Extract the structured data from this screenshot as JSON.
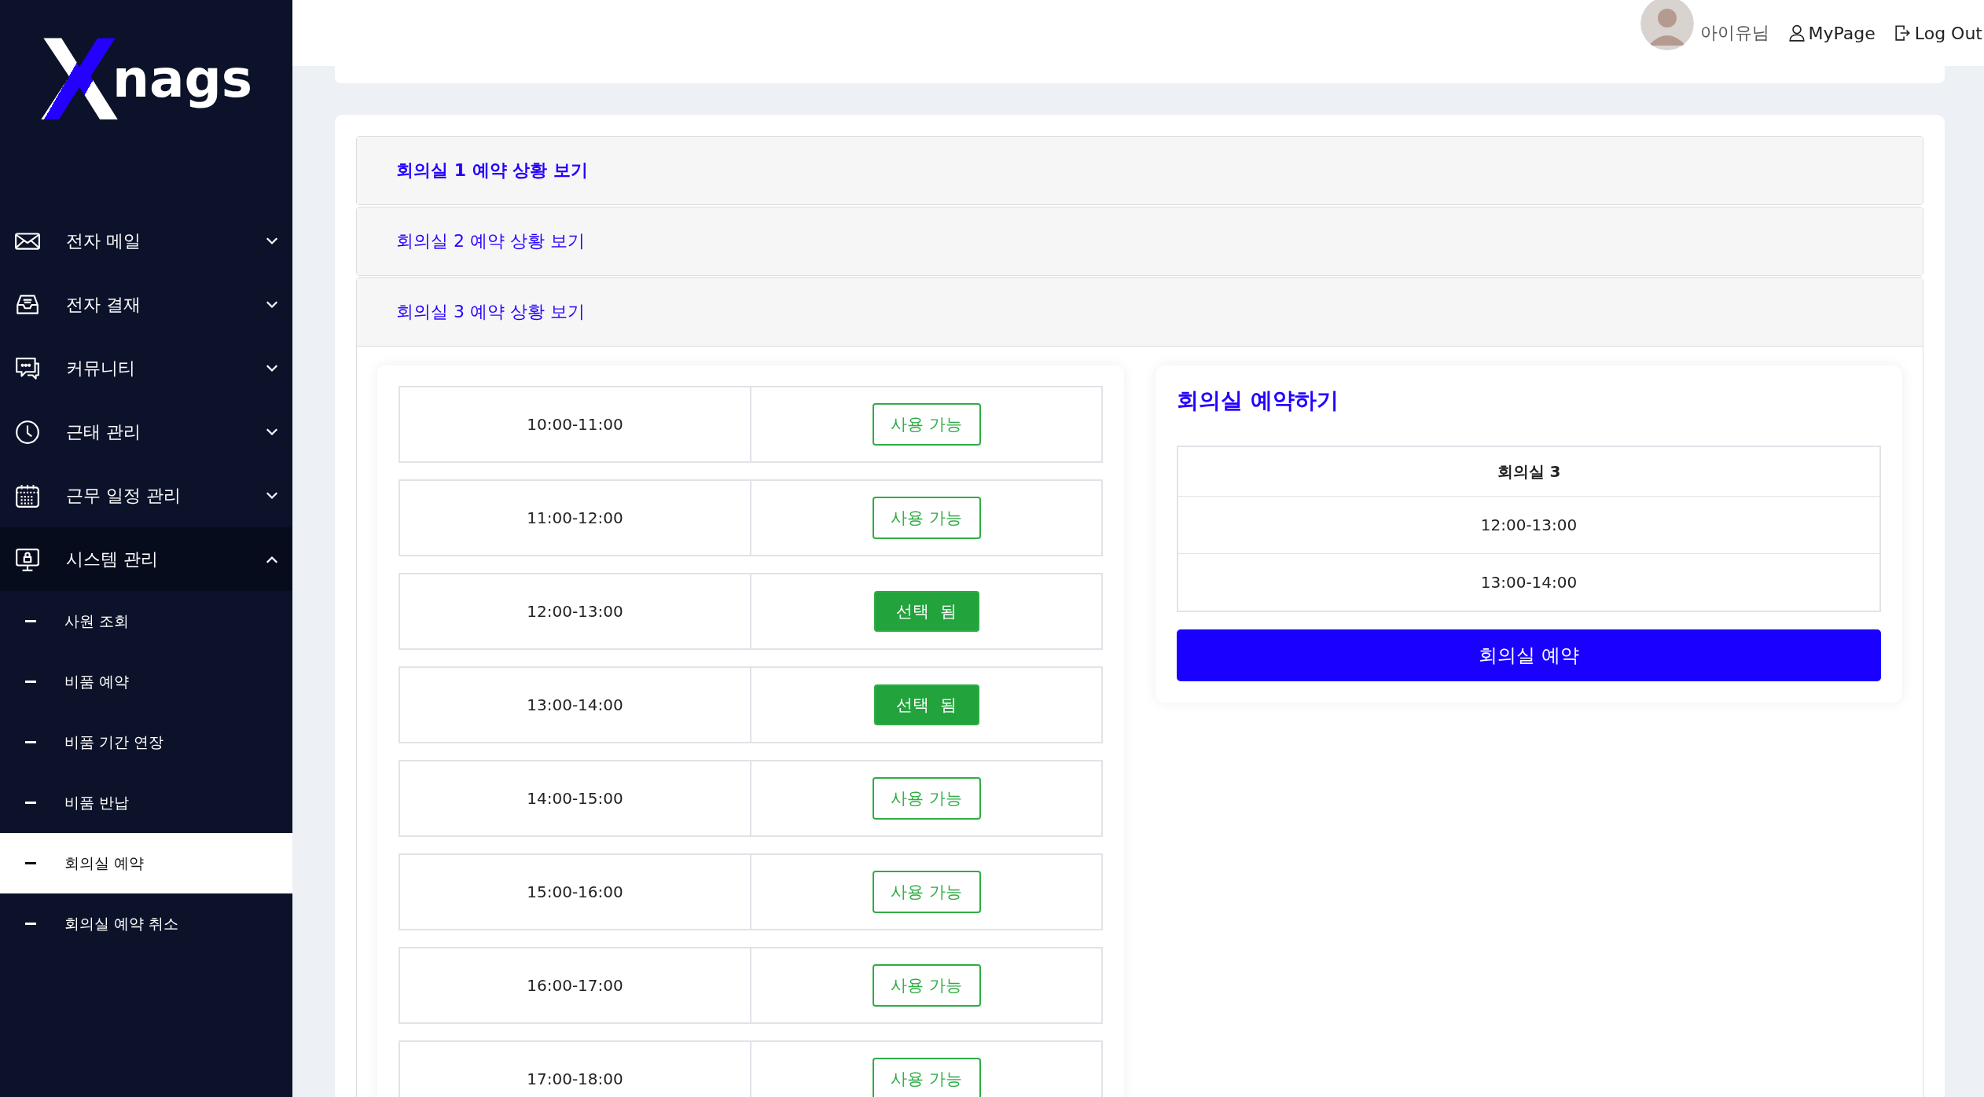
{
  "logo": {
    "mark": "X",
    "name": "nags"
  },
  "sidebar": {
    "items": [
      {
        "label": "전자 메일",
        "expanded": false
      },
      {
        "label": "전자 결재",
        "expanded": false
      },
      {
        "label": "커뮤니티",
        "expanded": false
      },
      {
        "label": "근태 관리",
        "expanded": false
      },
      {
        "label": "근무 일정 관리",
        "expanded": false
      },
      {
        "label": "시스템 관리",
        "expanded": true,
        "children": [
          {
            "label": "사원 조회",
            "selected": false
          },
          {
            "label": "비품 예약",
            "selected": false
          },
          {
            "label": "비품 기간 연장",
            "selected": false
          },
          {
            "label": "비품 반납",
            "selected": false
          },
          {
            "label": "회의실 예약",
            "selected": true
          },
          {
            "label": "회의실 예약 취소",
            "selected": false
          }
        ]
      }
    ]
  },
  "header": {
    "user": "아이유님",
    "mypage": "MyPage",
    "logout": "Log Out"
  },
  "accordion": [
    {
      "title": "회의실 1 예약 상황 보기",
      "selected": true,
      "expanded": false
    },
    {
      "title": "회의실 2 예약 상황 보기",
      "selected": false,
      "expanded": false
    },
    {
      "title": "회의실 3 예약 상황 보기",
      "selected": false,
      "expanded": true
    }
  ],
  "slots": [
    {
      "time": "10:00-11:00",
      "status": "사용 가능",
      "selected": false
    },
    {
      "time": "11:00-12:00",
      "status": "사용 가능",
      "selected": false
    },
    {
      "time": "12:00-13:00",
      "status": "선택  됨",
      "selected": true
    },
    {
      "time": "13:00-14:00",
      "status": "선택  됨",
      "selected": true
    },
    {
      "time": "14:00-15:00",
      "status": "사용 가능",
      "selected": false
    },
    {
      "time": "15:00-16:00",
      "status": "사용 가능",
      "selected": false
    },
    {
      "time": "16:00-17:00",
      "status": "사용 가능",
      "selected": false
    },
    {
      "time": "17:00-18:00",
      "status": "사용 가능",
      "selected": false
    }
  ],
  "booking": {
    "title": "회의실 예약하기",
    "room": "회의실 3",
    "times": [
      "12:00-13:00",
      "13:00-14:00"
    ],
    "button": "회의실 예약"
  }
}
